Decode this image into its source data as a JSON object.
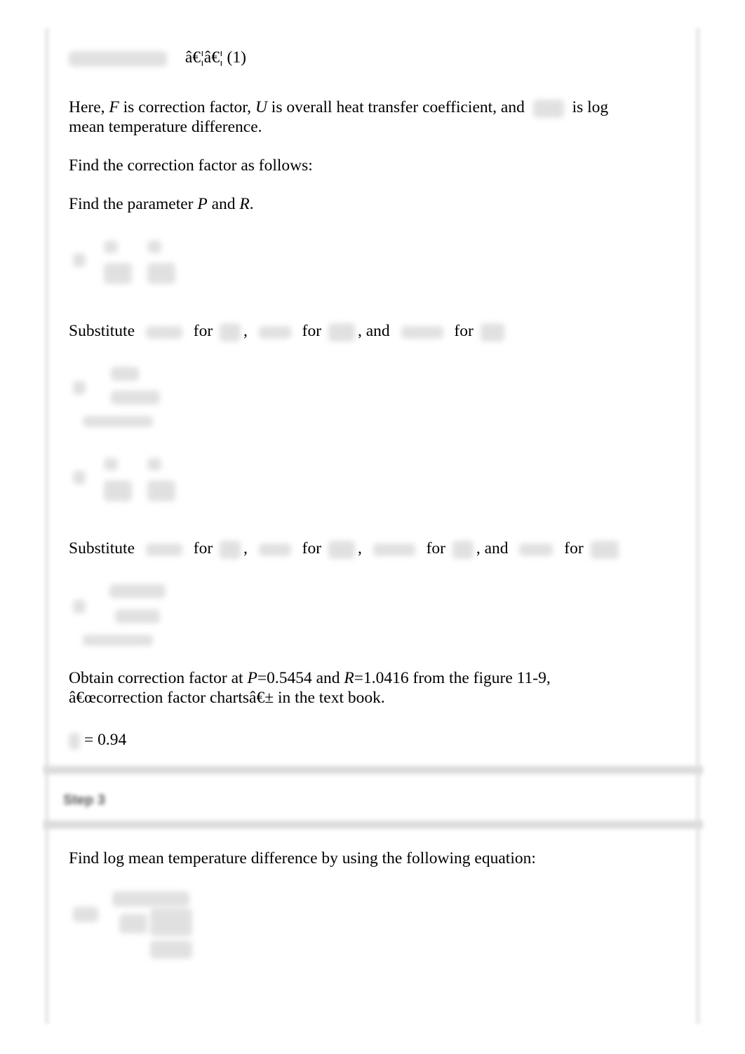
{
  "equation_1": {
    "label_suffix": "â€¦â€¦ (1)"
  },
  "paragraphs": {
    "here_prefix": "Here, ",
    "F": "F",
    "is_correction": " is correction factor, ",
    "U": "U",
    "is_overall": " is overall heat transfer coefficient, and ",
    "is_log": " is log",
    "line2": "mean temperature difference.",
    "find_correction": "Find the correction factor as follows:",
    "find_param_prefix": "Find the parameter ",
    "P": "P",
    "and": " and ",
    "R": "R",
    "period": "."
  },
  "substitute_1": {
    "word": "Substitute",
    "for": "for",
    "comma": ",",
    "and": ", and"
  },
  "substitute_2": {
    "word": "Substitute",
    "for": "for",
    "comma": ",",
    "and": ", and"
  },
  "obtain": {
    "prefix": "Obtain correction factor at ",
    "P": "P",
    "p_value": "=0.5454 and ",
    "R": "R",
    "r_value": "=1.0416 from the figure 11-9,",
    "line2": "â€œcorrection factor chartsâ€± in the text book."
  },
  "result": {
    "value": "= 0.94"
  },
  "step": {
    "title": "Step 3"
  },
  "lmtd": {
    "text": "Find log mean temperature difference by using the following equation:"
  }
}
